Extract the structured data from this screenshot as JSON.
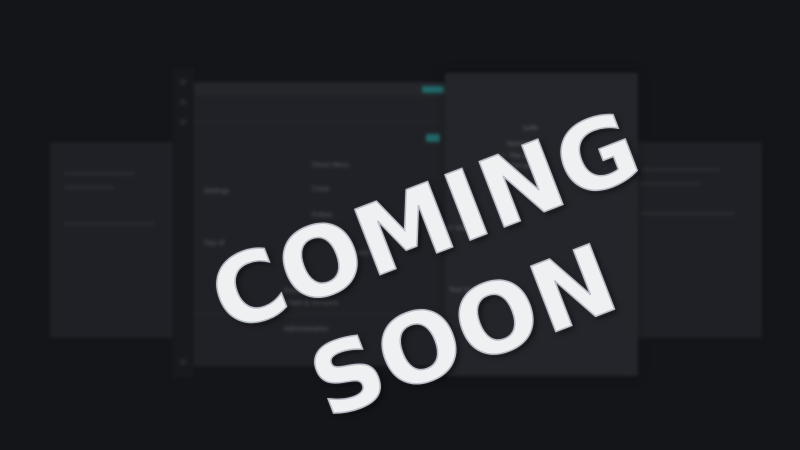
{
  "banner": {
    "line1": "COMING",
    "line2": "SOON"
  },
  "background_app": {
    "list_items": [
      "Direct Mess",
      "Creat",
      "Follow",
      "Settings",
      "Day of",
      "Account",
      "Preview",
      "Share & Versions",
      "Administration"
    ],
    "detail": {
      "description_tail": "suite",
      "priority_value": "Normal",
      "steps": [
        "1. The user",
        "2. The user"
      ],
      "frag1": "or video.",
      "frag2": "Test Suite"
    }
  },
  "colors": {
    "accent": "#2fa6a3",
    "banner_text": "#eef0f2"
  }
}
